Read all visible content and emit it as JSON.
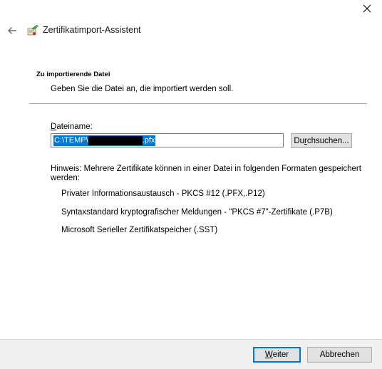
{
  "nav": {
    "title": "Zertifikatimport-Assistent"
  },
  "section": {
    "title": "Zu importierende Datei",
    "subtitle": "Geben Sie die Datei an, die importiert werden soll."
  },
  "file": {
    "label_mnemonic": "D",
    "label_rest": "ateiname:",
    "value_prefix": "C:\\TEMP\\",
    "value_suffix": ".pfx",
    "browse_mnemonic": "r",
    "browse_pre": "Du",
    "browse_post": "chsuchen..."
  },
  "hint": "Hinweis: Mehrere Zertifikate können in einer Datei in folgenden Formaten gespeichert werden:",
  "formats": [
    "Privater Informationsaustausch - PKCS #12 (.PFX,.P12)",
    "Syntaxstandard kryptografischer Meldungen - \"PKCS #7\"-Zertifikate (.P7B)",
    "Microsoft Serieller Zertifikatspeicher (.SST)"
  ],
  "footer": {
    "next_mnemonic": "W",
    "next_rest": "eiter",
    "cancel": "Abbrechen"
  }
}
